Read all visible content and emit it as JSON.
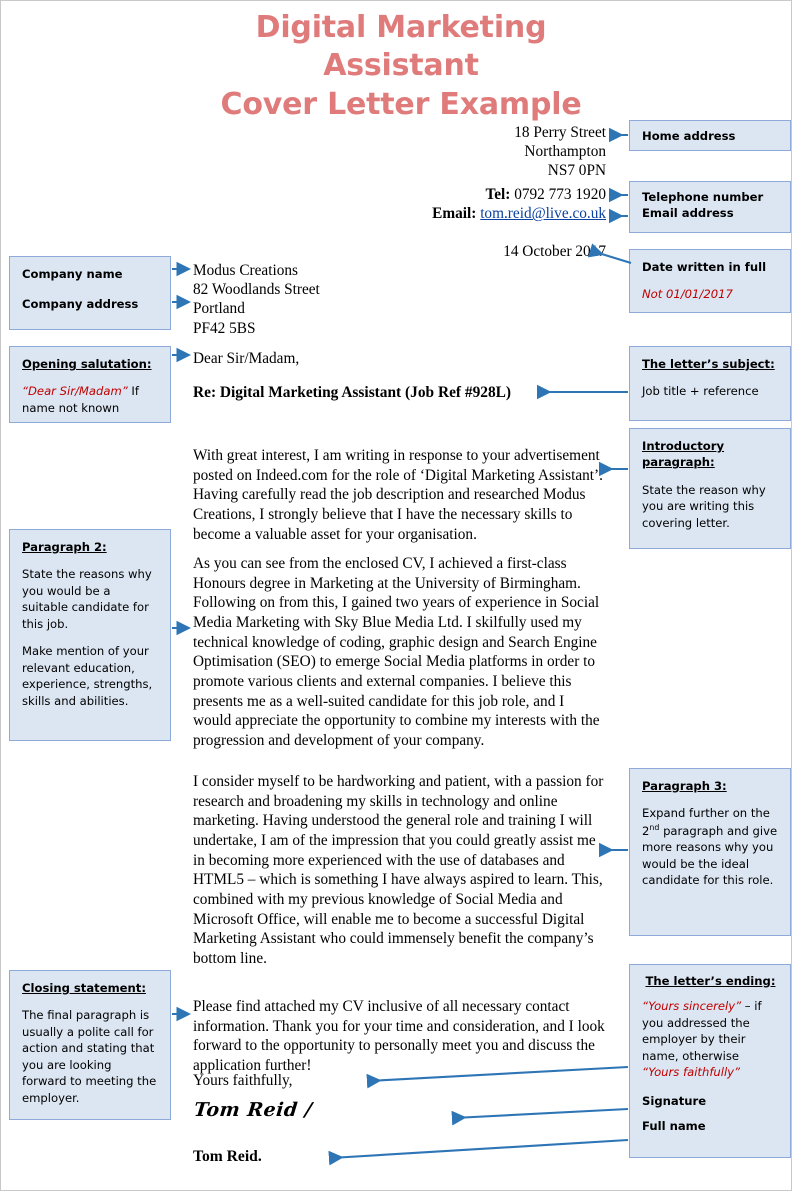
{
  "title": {
    "line1": "Digital Marketing",
    "line2": "Assistant",
    "line3": "Cover Letter Example",
    "color": "#e07b7b"
  },
  "letter": {
    "home_address": {
      "line1": "18 Perry Street",
      "line2": "Northampton",
      "line3": "NS7 0PN"
    },
    "contact": {
      "tel_label": "Tel:",
      "tel_value": "0792 773 1920",
      "email_label": "Email:",
      "email_value": "tom.reid@live.co.uk"
    },
    "date": "14 October 2017",
    "company": {
      "name": "Modus Creations",
      "street": "82 Woodlands Street",
      "city": "Portland",
      "postcode": "PF42 5BS"
    },
    "salutation": "Dear Sir/Madam,",
    "subject": "Re: Digital Marketing Assistant (Job Ref #928L)",
    "paragraph_1": "With great interest, I am writing in response to your advertisement posted on Indeed.com for the role of ‘Digital Marketing Assistant’. Having carefully read the job description and researched Modus Creations, I strongly believe that I have the necessary skills to become a valuable asset for your organisation.",
    "paragraph_2": "As you can see from the enclosed CV, I achieved a first-class Honours degree in Marketing at the University of Birmingham. Following on from this, I gained two years of experience in Social Media Marketing with Sky Blue Media Ltd. I skilfully used my technical knowledge of coding, graphic design and Search Engine Optimisation (SEO) to emerge Social Media platforms in order to promote various clients and external companies. I believe this presents me as a well-suited candidate for this job role, and I would appreciate the opportunity to combine my interests with the progression and development of your company.",
    "paragraph_3": "I consider myself to be hardworking and patient, with a passion for research and broadening my skills in technology and online marketing. Having understood the general role and training I will undertake, I am of the impression that you could greatly assist me in becoming more experienced with the use of databases and HTML5 – which is something I have always aspired to learn. This, combined with my previous knowledge of Social Media and Microsoft Office, will enable me to become a successful Digital Marketing Assistant who could immensely benefit the company’s bottom line.",
    "paragraph_4": "Please find attached my CV inclusive of all necessary contact information. Thank you for your time and consideration, and I look forward to the opportunity to personally meet you and discuss the application further!",
    "sign_off": "Yours faithfully,",
    "signature": "Tom Reid /",
    "full_name": "Tom Reid."
  },
  "callouts": {
    "home_address": {
      "heading": "Home address"
    },
    "contact": {
      "line1": "Telephone number",
      "line2": "Email address"
    },
    "date": {
      "heading": "Date written in full",
      "note": "Not 01/01/2017"
    },
    "company": {
      "line1": "Company name",
      "line2": "Company address"
    },
    "salutation": {
      "heading": "Opening salutation:",
      "quote": "“Dear Sir/Madam”",
      "body_rest": " If name not known"
    },
    "subject": {
      "heading": "The letter’s subject:",
      "body": "Job title + reference"
    },
    "intro": {
      "heading_line1": "Introductory",
      "heading_line2": "paragraph:",
      "body": "State the reason why you are writing this covering letter."
    },
    "paragraph_2": {
      "heading": "Paragraph 2:",
      "body_1": "State the reasons why you would be a suitable candidate for this job.",
      "body_2": "Make mention of your relevant education, experience, strengths, skills and abilities."
    },
    "paragraph_3": {
      "heading": "Paragraph 3:",
      "body_pre": "Expand further on the 2",
      "body_sup": "nd",
      "body_post": " paragraph and give more reasons why you would be the ideal candidate for this role."
    },
    "closing": {
      "heading": "Closing statement:",
      "body": "The final paragraph is usually a polite call for action and stating that you are looking forward to meeting the employer."
    },
    "ending": {
      "heading": "The letter’s ending:",
      "quote_1": "“Yours sincerely”",
      "mid": " – if you addressed the employer by their name, otherwise ",
      "quote_2": "“Yours faithfully”",
      "signature_label": "Signature",
      "fullname_label": "Full name"
    }
  },
  "colors": {
    "callout_fill": "#dce6f2",
    "callout_border": "#8eaadb",
    "arrow": "#2e75b6",
    "accent_red": "#c00000",
    "title": "#e07b7b",
    "link": "#0b41a0"
  }
}
